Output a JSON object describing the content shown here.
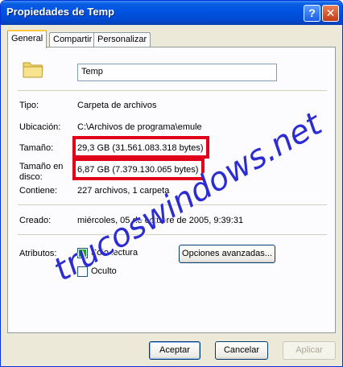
{
  "window": {
    "title": "Propiedades de Temp",
    "help_label": "?",
    "close_label": "✕"
  },
  "tabs": [
    {
      "label": "General"
    },
    {
      "label": "Compartir"
    },
    {
      "label": "Personalizar"
    }
  ],
  "general": {
    "name_value": "Temp",
    "tipo_label": "Tipo:",
    "tipo_value": "Carpeta de archivos",
    "ubicacion_label": "Ubicación:",
    "ubicacion_value": "C:\\Archivos de programa\\emule",
    "tamano_label": "Tamaño:",
    "tamano_value": "29,3 GB (31.561.083.318 bytes)",
    "tamano_disco_label_1": "Tamaño en",
    "tamano_disco_label_2": "disco:",
    "tamano_disco_value": "6,87 GB (7.379.130.065 bytes)",
    "contiene_label": "Contiene:",
    "contiene_value": "227 archivos, 1 carpeta",
    "creado_label": "Creado:",
    "creado_value": "miércoles, 05 de octubre de 2005, 9:39:31",
    "atributos_label": "Atributos:",
    "solo_lectura_label": "Sólo lectura",
    "oculto_label": "Oculto",
    "opciones_avanzadas_label": "Opciones avanzadas..."
  },
  "footer": {
    "aceptar": "Aceptar",
    "cancelar": "Cancelar",
    "aplicar": "Aplicar"
  },
  "watermark": "trucoswindows.net",
  "colors": {
    "titlebar": "#0054e3",
    "highlight_box": "#e0001a",
    "watermark": "#2c2cd2"
  }
}
